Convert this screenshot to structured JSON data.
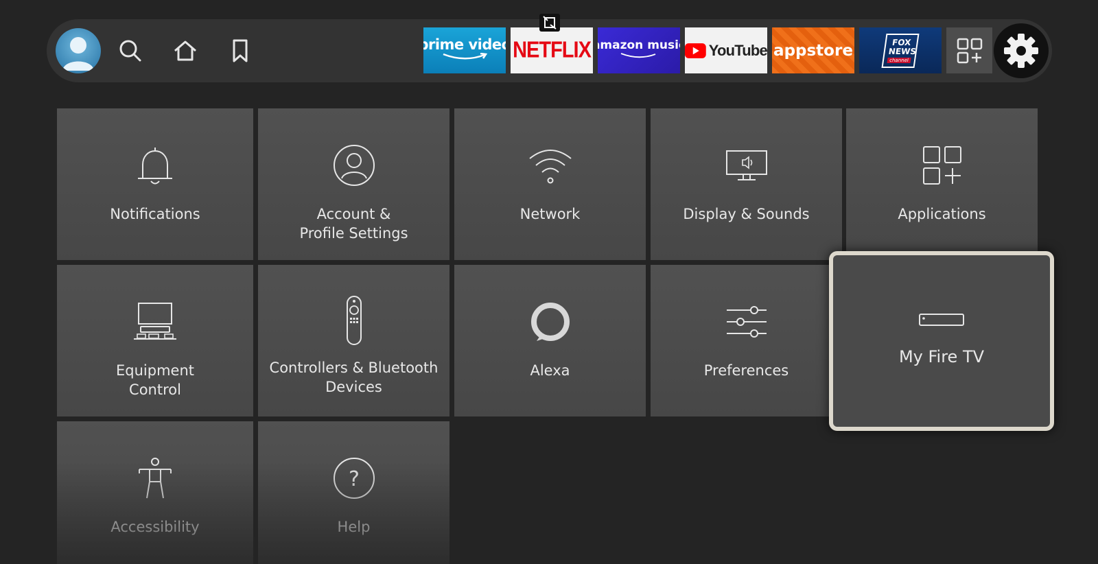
{
  "nav": {
    "items": [
      {
        "name": "profile-avatar"
      },
      {
        "name": "search-icon"
      },
      {
        "name": "home-icon"
      },
      {
        "name": "watchlist-icon"
      }
    ]
  },
  "apps": [
    {
      "id": "prime-video",
      "label": "prime video"
    },
    {
      "id": "netflix",
      "label": "NETFLIX"
    },
    {
      "id": "amazon-music",
      "label": "amazon music"
    },
    {
      "id": "youtube",
      "label": "YouTube"
    },
    {
      "id": "appstore",
      "label": "appstore"
    },
    {
      "id": "fox-news",
      "label": "FOX NEWS",
      "sublabel": "channel"
    }
  ],
  "settings": {
    "tiles": [
      {
        "label": "Notifications",
        "icon": "bell-icon"
      },
      {
        "label": "Account & Profile Settings",
        "icon": "user-circle-icon"
      },
      {
        "label": "Network",
        "icon": "wifi-icon"
      },
      {
        "label": "Display & Sounds",
        "icon": "monitor-sound-icon"
      },
      {
        "label": "Applications",
        "icon": "apps-grid-icon"
      },
      {
        "label": "Equipment Control",
        "icon": "tv-equipment-icon"
      },
      {
        "label": "Controllers & Bluetooth Devices",
        "icon": "remote-icon"
      },
      {
        "label": "Alexa",
        "icon": "alexa-ring-icon"
      },
      {
        "label": "Preferences",
        "icon": "sliders-icon"
      },
      {
        "label": "My Fire TV",
        "icon": "fire-tv-device-icon",
        "focused": true
      },
      {
        "label": "Accessibility",
        "icon": "accessibility-icon"
      },
      {
        "label": "Help",
        "icon": "help-icon"
      }
    ]
  },
  "colors": {
    "background": "#242424",
    "tile": "#4d4d4d",
    "focus_border": "#ddd8cc",
    "topbar": "#333333"
  }
}
